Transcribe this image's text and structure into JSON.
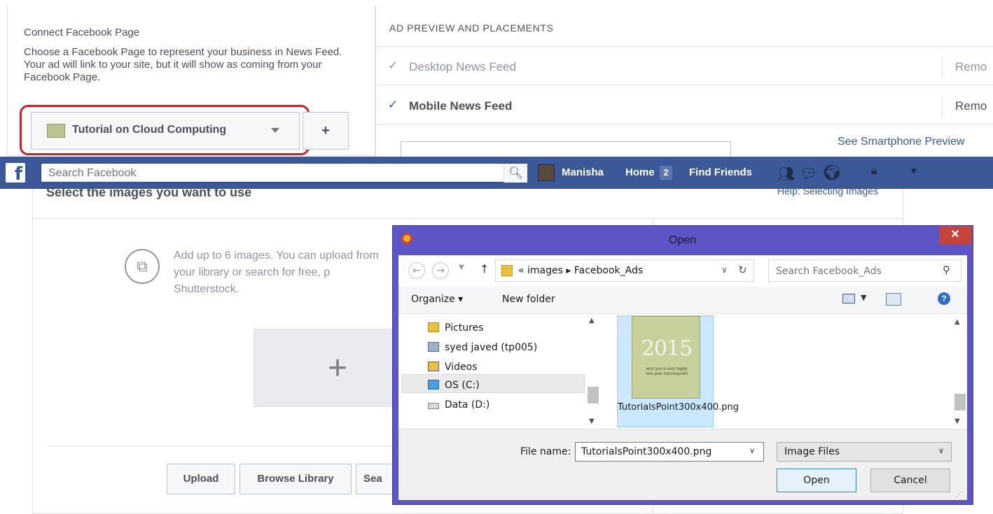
{
  "connect": {
    "title": "Connect Facebook Page",
    "description": "Choose a Facebook Page to represent your business in News Feed. Your ad will link to your site, but it will show as coming from your Facebook Page.",
    "selected_page": "Tutorial on Cloud Computing",
    "add_label": "+"
  },
  "preview": {
    "title": "AD PREVIEW AND PLACEMENTS",
    "placements": [
      {
        "label": "Desktop News Feed",
        "action": "Remo",
        "state": "inactive"
      },
      {
        "label": "Mobile News Feed",
        "action": "Remo",
        "state": "active"
      }
    ],
    "smartphone_link": "See Smartphone Preview"
  },
  "fb_bar": {
    "logo": "f",
    "search_placeholder": "Search Facebook",
    "search_icon": "magnifier-icon",
    "user_name": "Manisha",
    "home_label": "Home",
    "home_count": "2",
    "find_friends": "Find Friends",
    "icons": [
      "friend-requests-icon",
      "messages-icon",
      "notifications-icon",
      "privacy-icon",
      "menu-icon"
    ]
  },
  "images": {
    "heading": "Select the images you want to use",
    "help_link": "Help: Selecting Images",
    "hint": "Add up to 6 images. You can upload from your library or search for free, p Shutterstock.",
    "add_tile": "+",
    "buttons": [
      "Upload",
      "Browse Library",
      "Sea"
    ]
  },
  "dialog": {
    "title": "Open",
    "close": "✕",
    "address": "« images ▸ Facebook_Ads",
    "search_placeholder": "Search Facebook_Ads",
    "organize": "Organize ▾",
    "new_folder": "New folder",
    "help": "?",
    "tree": [
      {
        "label": "Pictures",
        "icon": "pictures-folder-icon"
      },
      {
        "label": "syed javed (tp005)",
        "icon": "network-computer-icon"
      },
      {
        "label": "Videos",
        "icon": "videos-folder-icon"
      },
      {
        "label": "OS (C:)",
        "icon": "system-drive-icon"
      },
      {
        "label": "Data (D:)",
        "icon": "hard-drive-icon"
      }
    ],
    "selected_tree": "OS (C:)",
    "file": {
      "name": "TutorialsPoint300x400.png",
      "thumb_year": "2015",
      "thumb_text": "wish you a very happy new year tutorialspoint"
    },
    "file_name_label": "File name:",
    "file_name_value": "TutorialsPoint300x400.png",
    "file_type": "Image Files",
    "open_label": "Open",
    "cancel_label": "Cancel"
  },
  "colors": {
    "facebook_blue": "#3b5998",
    "dialog_frame": "#5d54c6",
    "highlight_ring": "#c4242a",
    "close_red": "#c7443a"
  }
}
